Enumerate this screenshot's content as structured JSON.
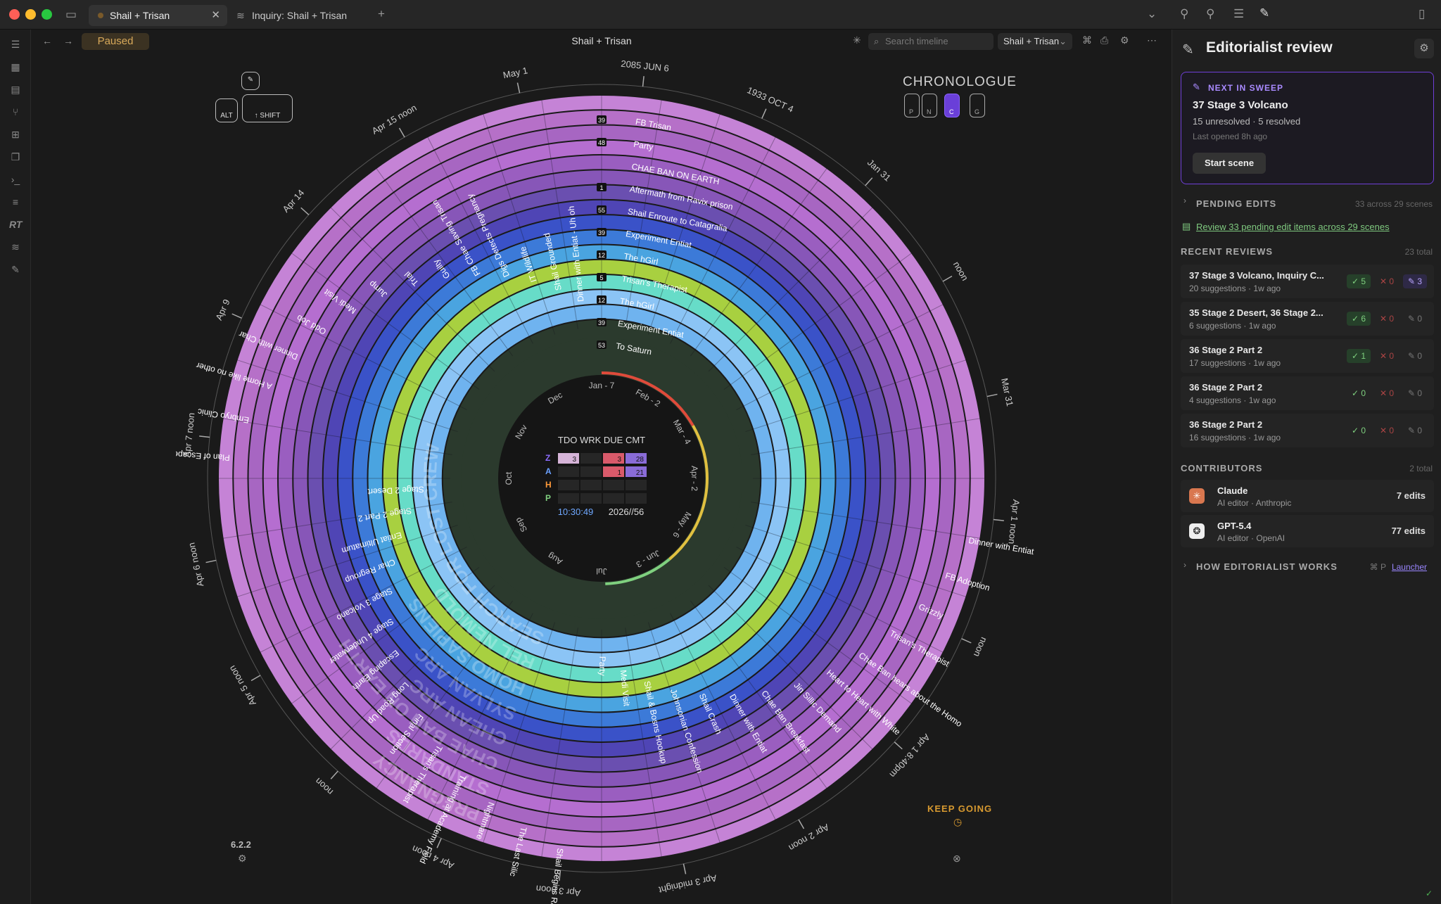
{
  "window": {
    "tabs": [
      {
        "label": "Shail + Trisan",
        "active": true
      },
      {
        "label": "Inquiry: Shail + Trisan",
        "active": false
      }
    ]
  },
  "header": {
    "status": "Paused",
    "title": "Shail + Trisan",
    "search_placeholder": "Search timeline",
    "scope": "Shail + Trisan"
  },
  "chronologue": {
    "title": "CHRONOLOGUE",
    "keys": [
      "P",
      "N",
      "C",
      "G"
    ],
    "active_key": "C",
    "modifier_keys": [
      "ALT",
      "↑ SHIFT"
    ],
    "version": "6.2.2",
    "keep_going": "KEEP GOING"
  },
  "center": {
    "columns": [
      "TDO",
      "WRK",
      "DUE",
      "CMT"
    ],
    "rows": [
      {
        "label": "Z",
        "color": "#8c6cff",
        "cells": [
          "3",
          "",
          "3",
          "28"
        ]
      },
      {
        "label": "A",
        "color": "#6aa0ff",
        "cells": [
          "",
          "",
          "1",
          "21"
        ]
      },
      {
        "label": "H",
        "color": "#ff9a3a",
        "cells": [
          "",
          "",
          "",
          ""
        ]
      },
      {
        "label": "P",
        "color": "#7fd07f",
        "cells": [
          "",
          "",
          "",
          ""
        ]
      }
    ],
    "clock": "10:30:49",
    "date": "2026//56",
    "months": [
      "Dec",
      "Jan - 7",
      "Feb - 2",
      "Mar - 4",
      "Apr - 2",
      "May - 6",
      "Jun - 3",
      "Jul",
      "Aug",
      "Sep",
      "Oct",
      "Nov"
    ]
  },
  "outer_labels": [
    "May 1",
    "2085 JUN 6",
    "1933 OCT 4",
    "Jan 31",
    "noon",
    "Mar 31",
    "Apr 1 noon",
    "noon",
    "Apr 1 8:40pm",
    "Apr 2 noon",
    "Apr 3 midnight",
    "Apr 3 noon",
    "Apr 4 noon",
    "noon",
    "Apr 5 noon",
    "Apr 6 noon",
    "Apr 7 noon",
    "Apr 9",
    "Apr 14",
    "Apr 15 noon"
  ],
  "rings": [
    {
      "color": "#2a3a2a",
      "text": "To Saturn",
      "count": "53"
    },
    {
      "color": "#8bc4f5",
      "text": "Experiment Entiat",
      "count": "39"
    },
    {
      "color": "#67dcc8",
      "text": "The hGirl",
      "count": "12"
    },
    {
      "color": "#a8d040",
      "text": "Trisan's Therapist",
      "count": "5"
    },
    {
      "color": "#4a82d8",
      "text": "The hGirl",
      "count": "12"
    },
    {
      "color": "#3a4fc0",
      "text": "Experiment Entiat",
      "count": "39"
    },
    {
      "color": "#5b4da8",
      "text": "Shail Enroute to Catagralia",
      "count": "55"
    },
    {
      "color": "#9a60c0",
      "text": "Aftermath from Ravix prison",
      "count": "1"
    },
    {
      "color": "#b070c8",
      "text": "CHAE BAN ON EARTH",
      "count": ""
    },
    {
      "color": "#a868c0",
      "text": "Party",
      "count": "48"
    },
    {
      "color": "#c080d0",
      "text": "FB Trisan",
      "count": "39"
    }
  ],
  "ring_arcs": [
    "SEARCH FOR LOST CREW",
    "REL NEMOLD",
    "HOMO SAPIENS",
    "SYLVAN ARC",
    "CHEAN ARC",
    "CHAE BAN ON EARTH",
    "STANDARDS",
    "PREGNANCY"
  ],
  "scenes": [
    "Dinner with Entiat - Uh oh",
    "FB Adoption",
    "Grizzly",
    "Trisan's Therapist",
    "Chae Ban hears about the Homo",
    "Heart to Heart with White",
    "Jin Sillic Demand",
    "Chae Ban Breakfast",
    "Dinner with Entiat",
    "Shail Crash",
    "Johnsonian Confession",
    "Shail & Bosns Hookup",
    "Medi Visit",
    "Party",
    "Shail Begins Race",
    "The Last Silic",
    "Nightmare",
    "Training at Academy Field",
    "Trisan's Therapist",
    "Final Section",
    "Long Road Up",
    "Escaping Earth",
    "Stage 4 Underwater",
    "Stage 3 Volcano",
    "Char Regroup",
    "Entiat Ultimatum",
    "Stage 2 Part 2",
    "Stage 2 Desert",
    "Plan of Escape",
    "Embryo Clinic",
    "A Home like no other",
    "Dinner with Char",
    "Odd Job",
    "Medi Visit",
    "Jump",
    "Trial",
    "Guilty",
    "FB Chae Saving Trisan",
    "Digs Detects Pregnancy",
    "IT Wildlife",
    "Shail Grounded",
    "Dinner with Entiat - Uh oh"
  ],
  "panel": {
    "title": "Editorialist review",
    "next_in_sweep": {
      "label": "NEXT IN SWEEP",
      "title": "37 Stage 3 Volcano",
      "meta": "15 unresolved · 5 resolved",
      "last": "Last opened 8h ago",
      "button": "Start scene"
    },
    "pending": {
      "label": "PENDING EDITS",
      "right": "33 across 29 scenes",
      "link": "Review 33 pending edit items across 29 scenes"
    },
    "recent": {
      "label": "RECENT REVIEWS",
      "right": "23 total",
      "items": [
        {
          "title": "37 Stage 3 Volcano, Inquiry C...",
          "sub": "20 suggestions · 1w ago",
          "ok": "5",
          "no": "0",
          "ed": "3"
        },
        {
          "title": "35 Stage 2 Desert, 36 Stage 2...",
          "sub": "6 suggestions · 1w ago",
          "ok": "6",
          "no": "0",
          "ed": "0"
        },
        {
          "title": "36 Stage 2 Part 2",
          "sub": "17 suggestions · 1w ago",
          "ok": "1",
          "no": "0",
          "ed": "0"
        },
        {
          "title": "36 Stage 2 Part 2",
          "sub": "4 suggestions · 1w ago",
          "ok": "0",
          "no": "0",
          "ed": "0"
        },
        {
          "title": "36 Stage 2 Part 2",
          "sub": "16 suggestions · 1w ago",
          "ok": "0",
          "no": "0",
          "ed": "0"
        }
      ]
    },
    "contributors": {
      "label": "CONTRIBUTORS",
      "right": "2 total",
      "items": [
        {
          "name": "Claude",
          "sub": "AI editor · Anthropic",
          "edits": "7 edits"
        },
        {
          "name": "GPT-5.4",
          "sub": "AI editor · OpenAI",
          "edits": "77 edits"
        }
      ]
    },
    "how": {
      "label": "HOW EDITORIALIST WORKS",
      "keys": "⌘ P",
      "link": "Launcher"
    }
  }
}
